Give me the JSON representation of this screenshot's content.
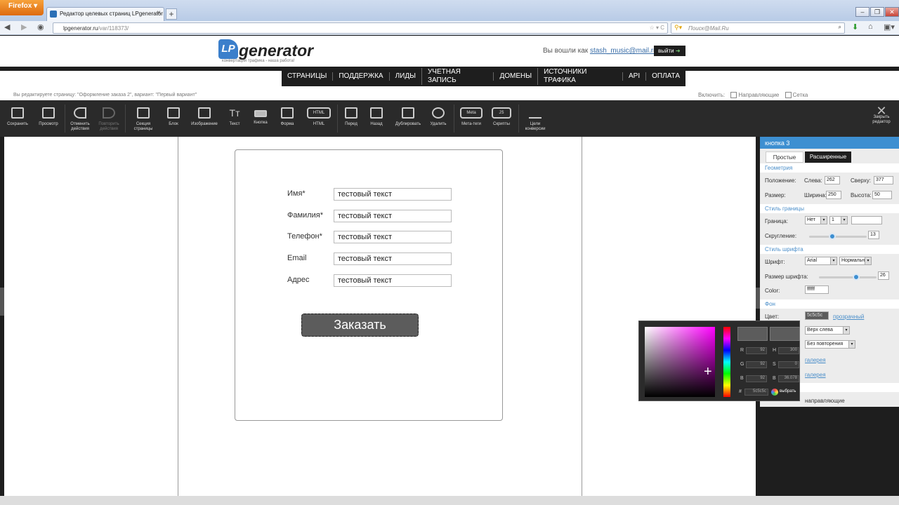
{
  "browser": {
    "app_button": "Firefox",
    "tab_title": "Редактор целевых страниц LPgenerator",
    "url_host": "lpgenerator.ru",
    "url_path": "/var/118373/",
    "search_placeholder": "Поиск@Mail.Ru"
  },
  "site": {
    "logo_mark": "LP",
    "logo_text": "generator",
    "tagline": "конвертация трафика - наша работа!",
    "logged_in_prefix": "Вы вошли как",
    "user_email": "stash_music@mail.ru",
    "logout": "выйти"
  },
  "menu": [
    "СТРАНИЦЫ",
    "ПОДДЕРЖКА",
    "ЛИДЫ",
    "УЧЕТНАЯ ЗАПИСЬ",
    "ДОМЕНЫ",
    "ИСТОЧНИКИ ТРАФИКА",
    "API",
    "ОПЛАТА"
  ],
  "edit_note": "Вы редактируете страницу: \"Оформление заказа 2\", вариант: \"Первый вариант\"",
  "include": {
    "label": "Включить:",
    "guides": "Направляющие",
    "grid": "Сетка"
  },
  "toolbar": [
    {
      "label": "Сохранить"
    },
    {
      "label": "Просмотр"
    },
    {
      "label": "Отменить действия"
    },
    {
      "label": "Повторить действия",
      "disabled": true
    },
    {
      "label": "Секция страницы"
    },
    {
      "label": "Блок"
    },
    {
      "label": "Изображение"
    },
    {
      "label": "Текст"
    },
    {
      "label": "Кнопка"
    },
    {
      "label": "Форма"
    },
    {
      "label": "HTML"
    },
    {
      "label": "Перед"
    },
    {
      "label": "Назад"
    },
    {
      "label": "Дублировать"
    },
    {
      "label": "Удалить"
    },
    {
      "label": "Мета-теги"
    },
    {
      "label": "Скрипты"
    },
    {
      "label": "Цели конверсии"
    }
  ],
  "toolbar_icon_text": {
    "html": "HTML",
    "meta": "Meta",
    "js": "JS"
  },
  "close_editor": "Закрыть редактор",
  "form": {
    "fields": [
      {
        "label": "Имя*",
        "value": "тестовый текст"
      },
      {
        "label": "Фамилия*",
        "value": "тестовый текст"
      },
      {
        "label": "Телефон*",
        "value": "тестовый текст"
      },
      {
        "label": "Email",
        "value": "тестовый текст"
      },
      {
        "label": "Адрес",
        "value": "тестовый текст"
      }
    ],
    "submit": "Заказать"
  },
  "panel": {
    "title": "кнопка 3",
    "tabs": [
      "Простые",
      "Расширенные"
    ],
    "geometry": "Геометрия",
    "position_label": "Положение:",
    "left_label": "Слева:",
    "left_value": "262",
    "top_label": "Сверху:",
    "top_value": "377",
    "size_label": "Размер:",
    "width_label": "Ширина:",
    "width_value": "250",
    "height_label": "Высота:",
    "height_value": "50",
    "border_style": "Стиль границы",
    "border_label": "Граница:",
    "border_value": "Нет",
    "border_width": "1",
    "radius_label": "Скругление:",
    "radius_value": "13",
    "font_style": "Стиль шрифта",
    "font_label": "Шрифт:",
    "font_value": "Arial",
    "font_weight": "Нормальн",
    "font_size_label": "Размер шрифта:",
    "font_size_value": "26",
    "color_label": "Color:",
    "color_value": "ffffff",
    "bg": "Фон",
    "bg_color_label": "Цвет:",
    "bg_color_value": "5c5c5c",
    "transparent": "прозрачный",
    "position_value": "Верх слева",
    "repeat_value": "Без повторения",
    "gallery1": "галерея",
    "gallery2": "галерея",
    "guides_text": "направляющие"
  },
  "picker": {
    "r_label": "R",
    "r": "92",
    "g_label": "G",
    "g": "92",
    "b_label": "B",
    "b": "92",
    "h_label": "H",
    "h": "300",
    "s_label": "S",
    "s": "0",
    "bv_label": "B",
    "bv": "36.078",
    "hash": "#",
    "hex": "5c5c5c",
    "choose": "выбрать"
  },
  "colors": {
    "accent": "#3d8fd1",
    "button_bg": "#5c5c5c",
    "toolbar": "#2a2a2a"
  }
}
